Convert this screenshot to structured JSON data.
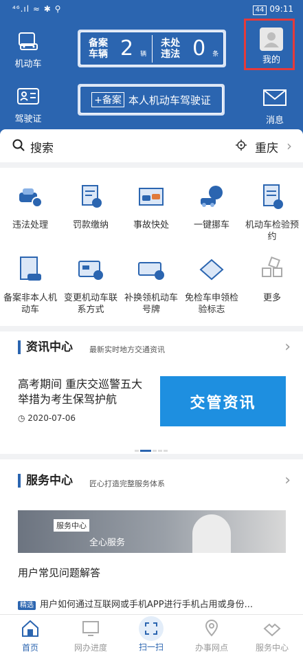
{
  "status_bar": {
    "left": "⁴⁶.ıl ≈ ✱ ⚲",
    "battery": "44",
    "time": "09:11"
  },
  "header": {
    "vehicle": "机动车",
    "license_label": "驾驶证",
    "mine": "我的",
    "messages": "消息",
    "plate": {
      "registered_label": "备案车辆",
      "registered_count": "2",
      "registered_unit": "辆",
      "violation_label": "未处违法",
      "violation_count": "0",
      "violation_unit": "条"
    },
    "register_license": {
      "prefix": "+备案",
      "text": "本人机动车驾驶证"
    }
  },
  "search": {
    "label": "搜索",
    "city": "重庆"
  },
  "services": [
    {
      "label": "违法处理",
      "icon": "car-violation-icon"
    },
    {
      "label": "罚款缴纳",
      "icon": "fine-payment-icon"
    },
    {
      "label": "事故快处",
      "icon": "accident-icon"
    },
    {
      "label": "一键挪车",
      "icon": "move-car-icon"
    },
    {
      "label": "机动车检验预约",
      "icon": "inspection-booking-icon"
    },
    {
      "label": "备案非本人机动车",
      "icon": "register-vehicle-icon"
    },
    {
      "label": "变更机动车联系方式",
      "icon": "change-contact-icon"
    },
    {
      "label": "补换领机动车号牌",
      "icon": "plate-replace-icon"
    },
    {
      "label": "免检车申领检验标志",
      "icon": "exempt-sign-icon"
    },
    {
      "label": "更多",
      "icon": "more-icon"
    }
  ],
  "news": {
    "title": "资讯中心",
    "subtitle": "最新实时地方交通资讯",
    "headline": "高考期间 重庆交巡警五大举措为考生保驾护航",
    "date": "2020-07-06",
    "image_text": "交管资讯"
  },
  "service_center": {
    "title": "服务中心",
    "subtitle": "匠心打造完整服务体系",
    "banner_tag": "服务中心",
    "banner_text": "全心服务",
    "faq_title": "用户常见问题解答",
    "faq_badge": "精选",
    "faq_item": "用户如何通过互联网或手机APP进行手机占用或身份..."
  },
  "tabbar": [
    {
      "label": "首页",
      "icon": "home-icon"
    },
    {
      "label": "网办进度",
      "icon": "progress-icon"
    },
    {
      "label": "扫一扫",
      "icon": "scan-icon"
    },
    {
      "label": "办事网点",
      "icon": "location-icon"
    },
    {
      "label": "服务中心",
      "icon": "service-icon"
    }
  ],
  "colors": {
    "primary": "#2b65b0",
    "highlight": "#e53a3a",
    "news_image": "#1e8fe0"
  }
}
